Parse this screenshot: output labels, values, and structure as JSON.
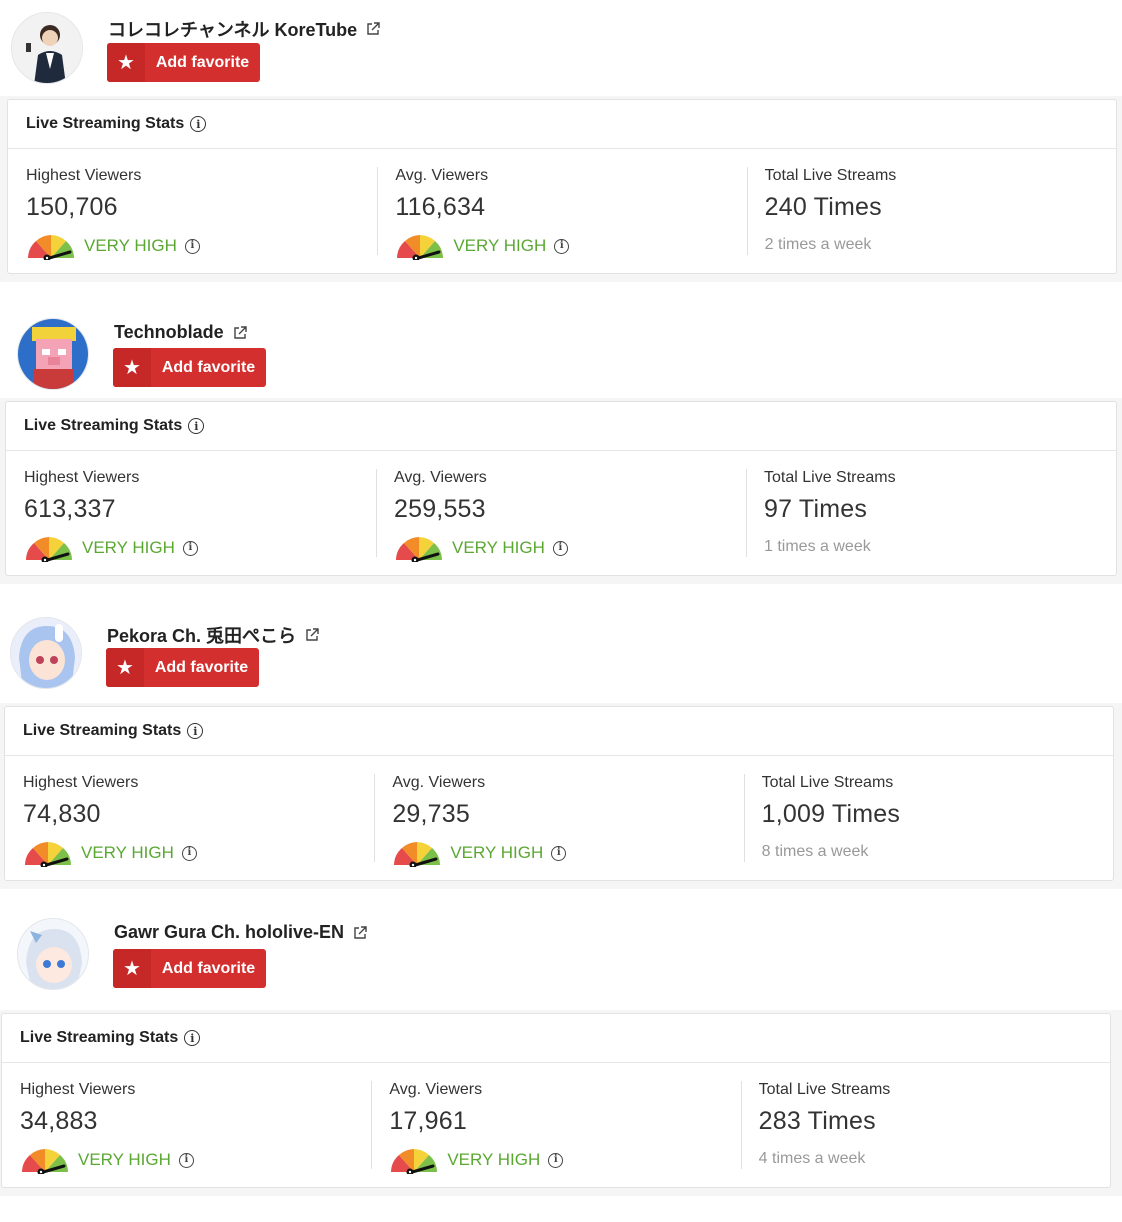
{
  "labels": {
    "add_favorite": "Add favorite",
    "stats_title": "Live Streaming Stats",
    "highest_viewers": "Highest Viewers",
    "avg_viewers": "Avg. Viewers",
    "total_live_streams": "Total Live Streams"
  },
  "colors": {
    "favorite_button": "#d32f2f",
    "rating_text": "#5aa832"
  },
  "channels": [
    {
      "name": "コレコレチャンネル KoreTube",
      "highest_viewers": "150,706",
      "highest_rating": "VERY HIGH",
      "avg_viewers": "116,634",
      "avg_rating": "VERY HIGH",
      "total_streams": "240 Times",
      "frequency": "2 times a week"
    },
    {
      "name": "Technoblade",
      "highest_viewers": "613,337",
      "highest_rating": "VERY HIGH",
      "avg_viewers": "259,553",
      "avg_rating": "VERY HIGH",
      "total_streams": "97 Times",
      "frequency": "1 times a week"
    },
    {
      "name": "Pekora Ch. 兎田ぺこら",
      "highest_viewers": "74,830",
      "highest_rating": "VERY HIGH",
      "avg_viewers": "29,735",
      "avg_rating": "VERY HIGH",
      "total_streams": "1,009 Times",
      "frequency": "8 times a week"
    },
    {
      "name": "Gawr Gura Ch. hololive-EN",
      "highest_viewers": "34,883",
      "highest_rating": "VERY HIGH",
      "avg_viewers": "17,961",
      "avg_rating": "VERY HIGH",
      "total_streams": "283 Times",
      "frequency": "4 times a week"
    }
  ]
}
